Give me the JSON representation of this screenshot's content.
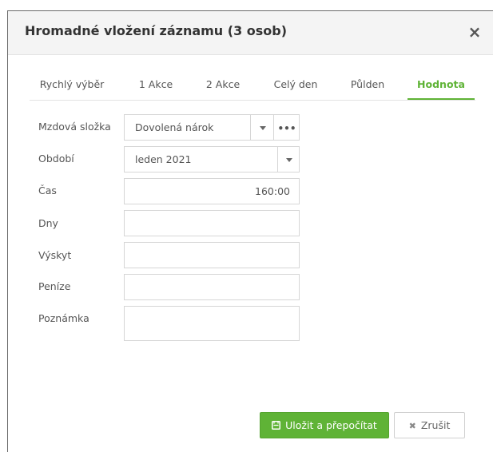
{
  "dialog": {
    "title": "Hromadné vložení záznamu (3 osob)",
    "close_label": "×"
  },
  "tabs": [
    {
      "label": "Rychlý výběr",
      "active": false
    },
    {
      "label": "1 Akce",
      "active": false
    },
    {
      "label": "2 Akce",
      "active": false
    },
    {
      "label": "Celý den",
      "active": false
    },
    {
      "label": "Půlden",
      "active": false
    },
    {
      "label": "Hodnota",
      "active": true
    }
  ],
  "form": {
    "mzdova_slozka": {
      "label": "Mzdová složka",
      "value": "Dovolená nárok",
      "more": "•••"
    },
    "obdobi": {
      "label": "Období",
      "value": "leden 2021"
    },
    "cas": {
      "label": "Čas",
      "value": "160:00"
    },
    "dny": {
      "label": "Dny",
      "value": ""
    },
    "vyskyt": {
      "label": "Výskyt",
      "value": ""
    },
    "penize": {
      "label": "Peníze",
      "value": ""
    },
    "poznamka": {
      "label": "Poznámka",
      "value": ""
    }
  },
  "buttons": {
    "save_label": "Uložit a přepočítat",
    "cancel_label": "Zrušit",
    "cancel_icon": "✖"
  },
  "colors": {
    "accent": "#5fb336",
    "header_bg": "#f4f4f4"
  }
}
